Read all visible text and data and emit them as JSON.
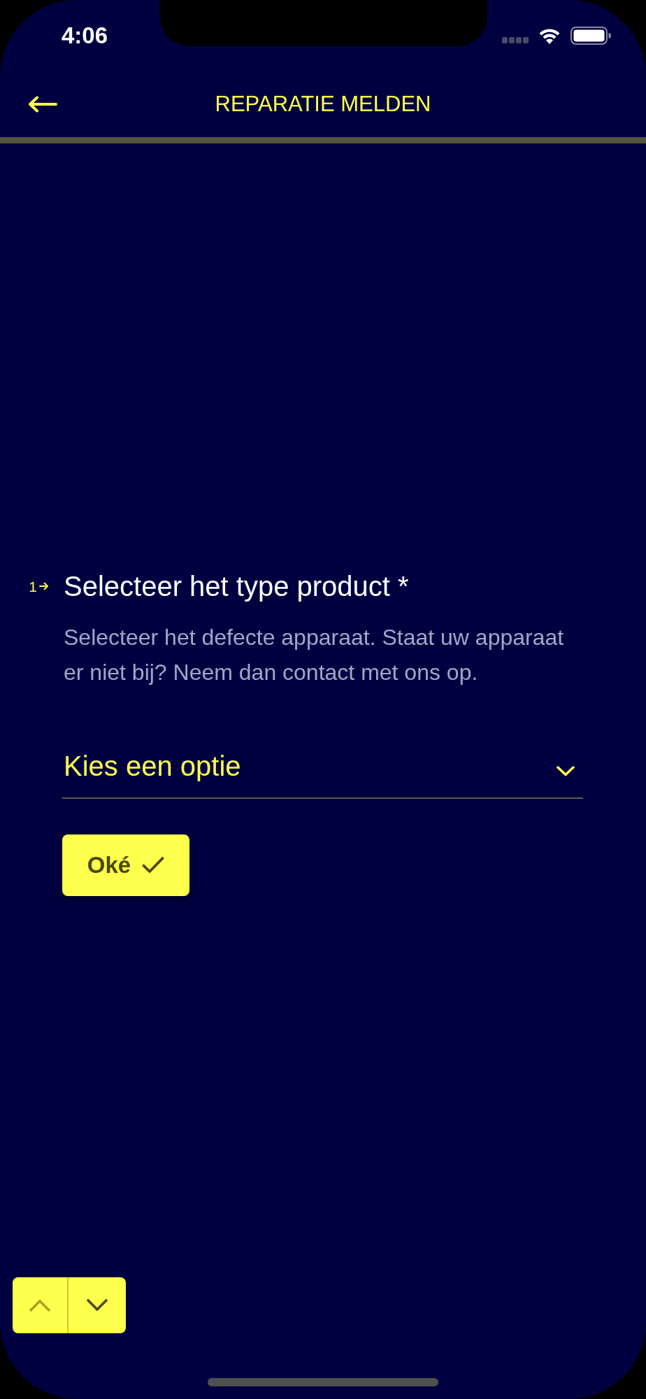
{
  "status_bar": {
    "time": "4:06"
  },
  "header": {
    "title": "REPARATIE MELDEN"
  },
  "progress": {
    "level": 0
  },
  "question": {
    "number": "1",
    "title": "Selecteer het type product *",
    "description": "Selecteer het defecte apparaat. Staat uw apparaat er niet bij? Neem dan contact met ons op.",
    "dropdown": {
      "placeholder": "Kies een optie"
    },
    "confirm_button": {
      "label": "Oké"
    }
  },
  "navigation": {
    "previous": {
      "disabled": true
    },
    "next": {
      "disabled": false
    }
  }
}
